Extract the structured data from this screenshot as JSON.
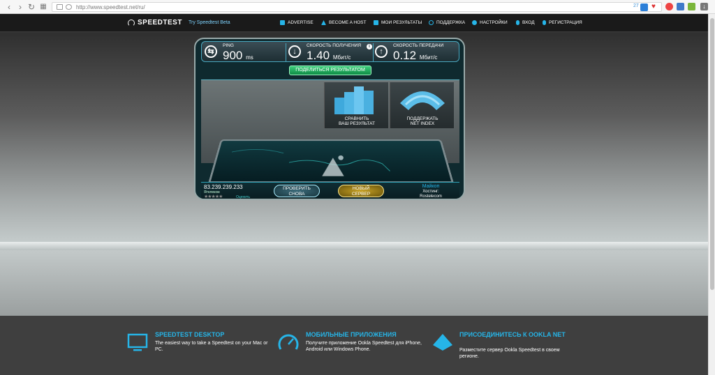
{
  "browser": {
    "url": "http://www.speedtest.net/ru/",
    "badge_count": "27"
  },
  "nav": {
    "logo": "SPEEDTEST",
    "beta": "Try Speedtest Beta",
    "items": [
      {
        "label": "ADVERTISE",
        "icon": "megaphone-icon"
      },
      {
        "label": "BECOME A HOST",
        "icon": "triangle-icon"
      },
      {
        "label": "МОИ РЕЗУЛЬТАТЫ",
        "icon": "camera-icon"
      },
      {
        "label": "ПОДДЕРЖКА",
        "icon": "info-icon"
      },
      {
        "label": "НАСТРОЙКИ",
        "icon": "gear-icon"
      },
      {
        "label": "ВХОД",
        "icon": "user-icon"
      },
      {
        "label": "РЕГИСТРАЦИЯ",
        "icon": "register-icon"
      }
    ]
  },
  "stats": {
    "ping_label": "PING",
    "ping_value": "900",
    "ping_unit": "ms",
    "download_label": "СКОРОСТЬ ПОЛУЧЕНИЯ",
    "download_value": "1.40",
    "download_unit": "Мбит/с",
    "upload_label": "СКОРОСТЬ ПЕРЕДАЧИ",
    "upload_value": "0.12",
    "upload_unit": "Мбит/с"
  },
  "share_button": "ПОДЕЛИТЬСЯ РЕЗУЛЬТАТОМ",
  "tiles": {
    "compare_line1": "СРАВНИТЬ",
    "compare_line2": "ВАШ РЕЗУЛЬТАТ",
    "support_line1": "ПОДДЕРЖАТЬ",
    "support_line2": "NET INDEX"
  },
  "bottom": {
    "ip": "83.239.239.233",
    "isp": "Ятелеком",
    "rate": "Оценить",
    "retest_line1": "ПРОВЕРИТЬ",
    "retest_line2": "СНОВА",
    "newserver_line1": "НОВЫЙ",
    "newserver_line2": "СЕРВЕР",
    "city": "Майкоп",
    "host_label": "Хостинг:",
    "host_name": "Rostelecom"
  },
  "footer": {
    "desktop_title": "SPEEDTEST DESKTOP",
    "desktop_desc": "The easiest way to take a Speedtest on your Mac or PC.",
    "mobile_title": "МОБИЛЬНЫЕ ПРИЛОЖЕНИЯ",
    "mobile_desc": "Получите приложение Ookla Speedtest для iPhone, Android или Windows Phone.",
    "ookla_title": "ПРИСОЕДИНИТЕСЬ К OOKLA NET",
    "ookla_desc": "Разместите сервер Ookla Speedtest в своем регионе."
  },
  "colors": {
    "accent": "#26b5e8",
    "share": "#2dbf6b",
    "newserver": "#c9a326"
  }
}
